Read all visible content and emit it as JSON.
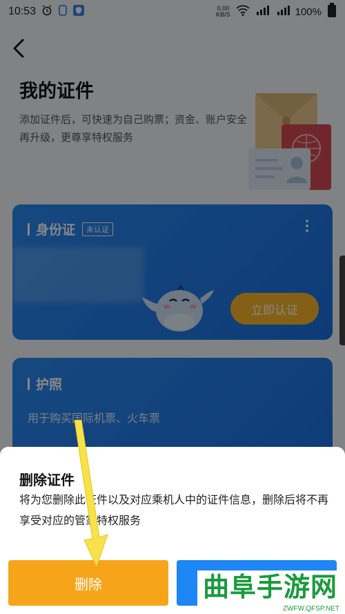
{
  "status_bar": {
    "time": "10:53",
    "speed_value": "0.00",
    "speed_unit": "KB/S",
    "battery": "100%"
  },
  "page": {
    "title": "我的证件",
    "subtitle": "添加证件后，可快速为自己购票；资金、账户安全再升级，更尊享特权服务"
  },
  "cards": {
    "id_card": {
      "title": "身份证",
      "badge": "未认证",
      "verify_label": "立即认证"
    },
    "passport": {
      "title": "护照",
      "description": "用于购买国际机票、火车票"
    }
  },
  "dialog": {
    "title": "删除证件",
    "message": "将为您删除此证件以及对应乘机人中的证件信息，删除后将不再享受对应的管家特权服务",
    "delete_label": "删除",
    "cancel_label": ""
  },
  "watermark": {
    "text": "曲阜手游网",
    "url": "ZWFW.QFSP.NET"
  },
  "colors": {
    "card_blue": "#1a6fe0",
    "delete_orange": "#f6a51b",
    "cancel_blue": "#1e86f5",
    "verify_gold": "#f7b52b"
  },
  "icons": [
    "alarm-icon",
    "notification-icon",
    "shield-app-icon",
    "wifi-icon",
    "signal-icon",
    "back-arrow-icon",
    "more-vertical-icon",
    "mascot-illustration",
    "documents-illustration",
    "pointer-arrow"
  ]
}
